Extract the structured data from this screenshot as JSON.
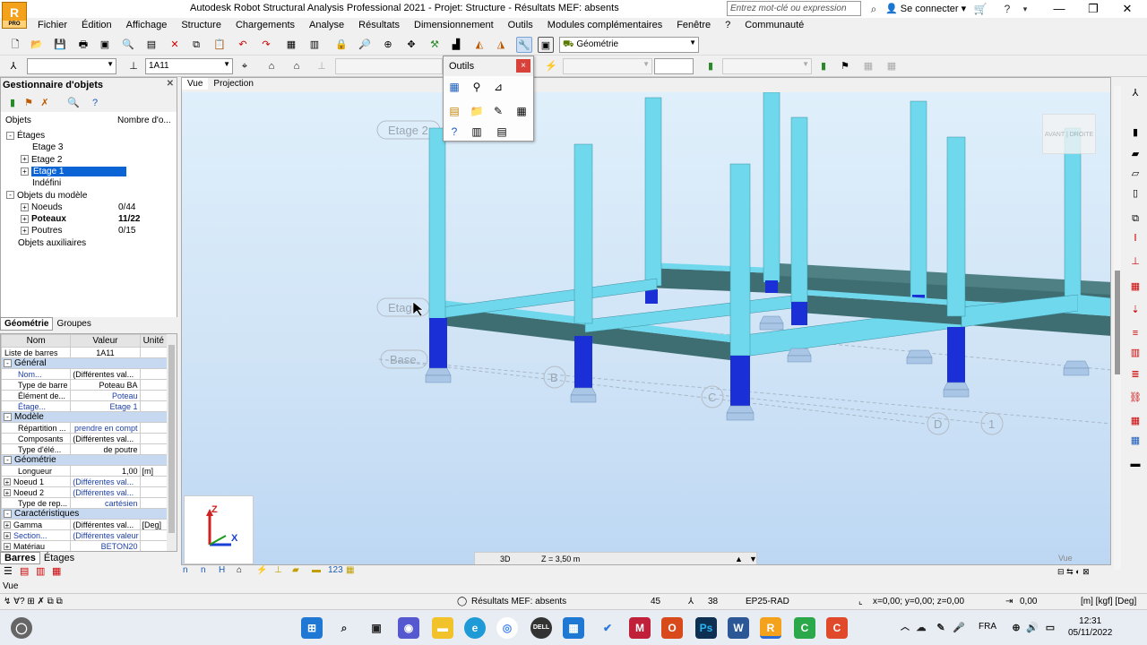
{
  "window": {
    "title": "Autodesk Robot Structural Analysis Professional 2021 - Projet: Structure - Résultats MEF: absents",
    "logo_letter": "R",
    "logo_sub": "PRO",
    "search_placeholder": "Entrez mot-clé ou expression",
    "signin": "Se connecter"
  },
  "menu": [
    "Fichier",
    "Édition",
    "Affichage",
    "Structure",
    "Chargements",
    "Analyse",
    "Résultats",
    "Dimensionnement",
    "Outils",
    "Modules complémentaires",
    "Fenêtre",
    "?",
    "Communauté"
  ],
  "toolbar": {
    "layout_select": "Géométrie",
    "bar_list_select": "1A11"
  },
  "outils": {
    "title": "Outils",
    "close": "×"
  },
  "object_manager": {
    "title": "Gestionnaire d'objets",
    "col_objects": "Objets",
    "col_count": "Nombre d'o...",
    "tree": [
      {
        "label": "Étages",
        "indent": 0,
        "exp": "-"
      },
      {
        "label": "Etage 3",
        "indent": 1,
        "exp": ""
      },
      {
        "label": "Etage 2",
        "indent": 1,
        "exp": "+"
      },
      {
        "label": "Etage 1",
        "indent": 1,
        "exp": "+",
        "selected": true
      },
      {
        "label": "Indéfini",
        "indent": 1,
        "exp": ""
      },
      {
        "label": "Objets du modèle",
        "indent": 0,
        "exp": "-"
      },
      {
        "label": "Noeuds",
        "indent": 1,
        "exp": "+",
        "count": "0/44"
      },
      {
        "label": "Poteaux",
        "indent": 1,
        "exp": "+",
        "count": "11/22",
        "bold": true
      },
      {
        "label": "Poutres",
        "indent": 1,
        "exp": "+",
        "count": "0/15"
      },
      {
        "label": "Objets auxiliaires",
        "indent": 0,
        "exp": ""
      }
    ],
    "tabs": [
      "Géométrie",
      "Groupes"
    ]
  },
  "properties": {
    "headers": [
      "Nom",
      "Valeur",
      "Unité"
    ],
    "rows": [
      {
        "type": "row",
        "name": "Liste de barres",
        "value": "1A11",
        "unit": ""
      },
      {
        "type": "group",
        "name": "Général"
      },
      {
        "type": "row",
        "name": "Nom...",
        "value": "(Différentes val...",
        "unit": "",
        "blue": true
      },
      {
        "type": "row",
        "name": "Type de barre",
        "value": "Poteau BA",
        "unit": ""
      },
      {
        "type": "row",
        "name": "Élément de...",
        "value": "Poteau",
        "unit": "",
        "vblue": true
      },
      {
        "type": "row",
        "name": "Étage...",
        "value": "Etage 1",
        "unit": "",
        "blue": true,
        "vblue": true
      },
      {
        "type": "group",
        "name": "Modèle"
      },
      {
        "type": "row",
        "name": "Répartition ...",
        "value": "prendre en compt",
        "unit": "",
        "vblue": true
      },
      {
        "type": "row",
        "name": "Composants",
        "value": "(Différentes val...",
        "unit": ""
      },
      {
        "type": "row",
        "name": "Type d'élé...",
        "value": "de poutre",
        "unit": ""
      },
      {
        "type": "group",
        "name": "Géométrie"
      },
      {
        "type": "row",
        "name": "Longueur",
        "value": "1,00",
        "unit": "[m]"
      },
      {
        "type": "row",
        "name": "Noeud 1",
        "value": "(Différentes val...",
        "unit": "",
        "exp": true,
        "vblue": true
      },
      {
        "type": "row",
        "name": "Noeud 2",
        "value": "(Différentes val...",
        "unit": "",
        "exp": true,
        "vblue": true
      },
      {
        "type": "row",
        "name": "Type de rep...",
        "value": "cartésien",
        "unit": "",
        "vblue": true
      },
      {
        "type": "group",
        "name": "Caractéristiques"
      },
      {
        "type": "row",
        "name": "Gamma",
        "value": "(Différentes val...",
        "unit": "[Deg]",
        "exp": true
      },
      {
        "type": "row",
        "name": "Section...",
        "value": "(Différentes valeur",
        "unit": "",
        "exp": true,
        "blue": true,
        "vblue": true
      },
      {
        "type": "row",
        "name": "Matériau",
        "value": "BETON20",
        "unit": "",
        "exp": true,
        "vblue": true
      }
    ],
    "bottom_tabs": [
      "Barres",
      "Étages"
    ]
  },
  "viewport": {
    "tabs": [
      "Vue",
      "Projection"
    ],
    "labels": {
      "etage2": "Etage 2",
      "etage1": "Etage",
      "base": "Base",
      "axB": "B",
      "axC": "C",
      "axD": "D",
      "ax1": "1"
    },
    "viewcube_front": "AVANT",
    "viewcube_right": "DROITE",
    "status_mode": "3D",
    "status_z": "Z = 3,50 m",
    "status_right": "Vue",
    "axis_labels": {
      "z": "Z",
      "x": "X"
    }
  },
  "statusbar": {
    "vue_label": "Vue",
    "results": "Résultats MEF: absents",
    "num1": "45",
    "num2": "38",
    "code": "EP25-RAD",
    "coords": "x=0,00; y=0,00; z=0,00",
    "value": "0,00",
    "units": "[m] [kgf] [Deg]"
  },
  "taskbar": {
    "lang": "FRA",
    "time": "12:31",
    "date": "05/11/2022"
  },
  "colors": {
    "column": "#6fd8ec",
    "beam_top": "#6fd8ec",
    "beam_side": "#3f6e72",
    "selected_column": "#1a2fd6",
    "footing": "#a9c6e6"
  }
}
